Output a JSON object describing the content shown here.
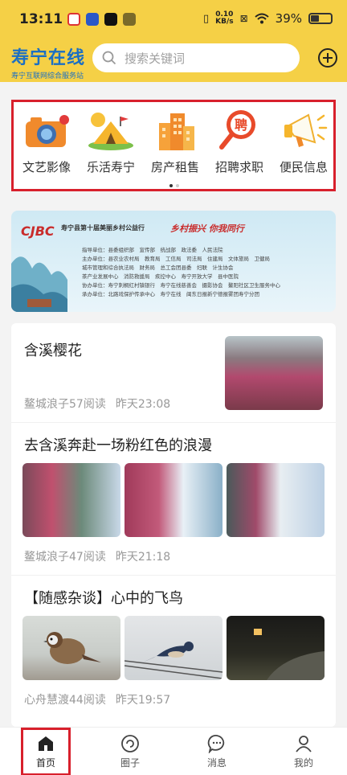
{
  "status_bar": {
    "time": "13:11",
    "speed_value": "0.10",
    "speed_unit": "KB/s",
    "battery": "39%"
  },
  "header": {
    "logo_name": "寿宁在线",
    "logo_sub": "寿宁互联网综合服务站",
    "search_placeholder": "搜索关键词",
    "add_icon": "plus-circle-icon"
  },
  "categories": [
    {
      "label": "文艺影像",
      "icon": "camera-icon"
    },
    {
      "label": "乐活寿宁",
      "icon": "tent-icon"
    },
    {
      "label": "房产租售",
      "icon": "buildings-icon"
    },
    {
      "label": "招聘求职",
      "icon": "recruit-magnifier-icon",
      "icon_text": "聘"
    },
    {
      "label": "便民信息",
      "icon": "megaphone-icon"
    }
  ],
  "banner": {
    "brand": "CJBC",
    "title": "寿宁县第十届美丽乡村公益行",
    "slogan": "乡村振兴 你我同行",
    "lines": [
      "指导单位：县委组织部　宣传部　统战部　政法委　人民法院",
      "主办单位：县农业农村局　教育局　工信局　司法局　住建局　文体旅局　卫健局",
      "城市管理和综合执法局　财务局　总工会团县委　妇联　计生协会",
      "茶产业发展中心　消防救援局　疾控中心　寿宁开放大学　县中医院",
      "协办单位：寿宁刺桐红村镇银行　寿宁在线慈善会　摄影协会　鳌阳社区卫生服务中心",
      "承办单位：北路戏保护传承中心　寿宁在线　闽东日报新宁德报雾团寿宁分团"
    ]
  },
  "feed": [
    {
      "title": "含溪樱花",
      "author": "鳌城浪子",
      "reads": "57阅读",
      "time": "昨天23:08"
    },
    {
      "title": "去含溪奔赴一场粉红色的浪漫",
      "author": "鳌城浪子",
      "reads": "47阅读",
      "time": "昨天21:18"
    },
    {
      "title": "【随感杂谈】心中的飞鸟",
      "author": "心舟慧渡",
      "reads": "44阅读",
      "time": "昨天19:57"
    }
  ],
  "nav": [
    {
      "label": "首页",
      "icon": "home-icon"
    },
    {
      "label": "圈子",
      "icon": "circle-icon"
    },
    {
      "label": "消息",
      "icon": "message-icon"
    },
    {
      "label": "我的",
      "icon": "user-icon"
    }
  ],
  "colors": {
    "brand_yellow": "#f5d046",
    "highlight_red": "#d8202c",
    "logo_blue": "#1b6fc4"
  }
}
